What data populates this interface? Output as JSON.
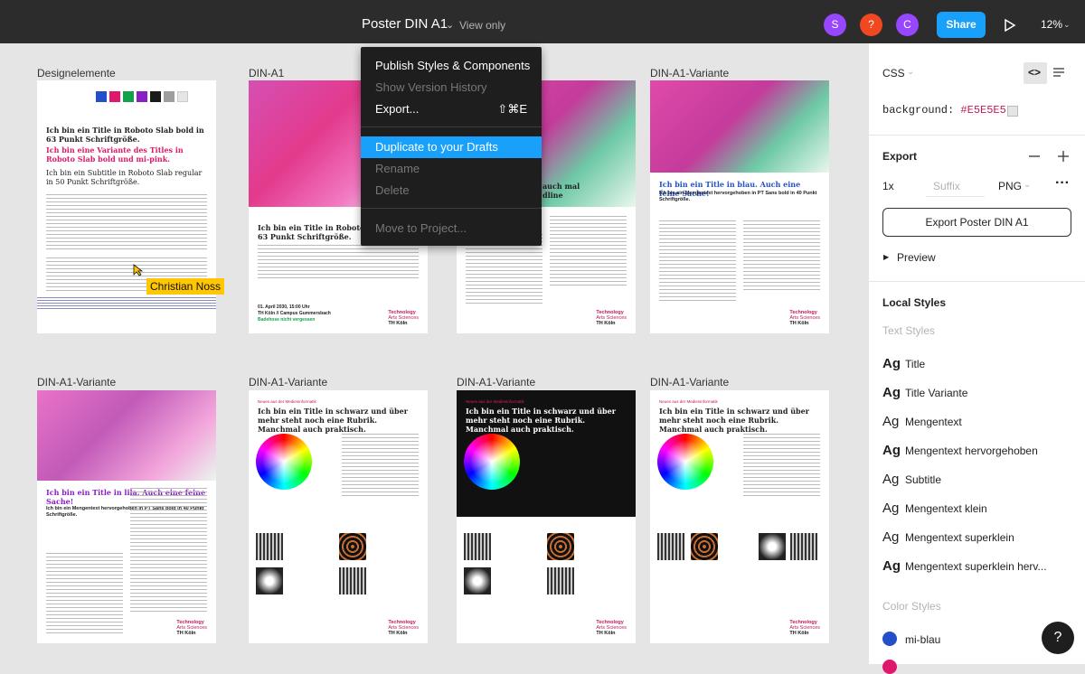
{
  "topbar": {
    "file_title": "Poster DIN A1",
    "view_only": "View only",
    "avatars": [
      {
        "letter": "S",
        "color": "#9747ff"
      },
      {
        "letter": "?",
        "color": "#f24822"
      },
      {
        "letter": "C",
        "color": "#9747ff"
      }
    ],
    "share_label": "Share",
    "zoom": "12%"
  },
  "dropdown": {
    "items": [
      {
        "label": "Publish Styles & Components",
        "state": "enabled"
      },
      {
        "label": "Show Version History",
        "state": "disabled"
      },
      {
        "label": "Export...",
        "shortcut": "⇧⌘E",
        "state": "enabled"
      },
      {
        "label": "Duplicate to your Drafts",
        "state": "highlighted"
      },
      {
        "label": "Rename",
        "state": "disabled"
      },
      {
        "label": "Delete",
        "state": "disabled"
      },
      {
        "label": "Move to Project...",
        "state": "disabled"
      }
    ]
  },
  "canvas": {
    "frames": [
      {
        "label": "Designelemente"
      },
      {
        "label": "DIN-A1"
      },
      {
        "label": ""
      },
      {
        "label": "DIN-A1-Variante"
      },
      {
        "label": "DIN-A1-Variante"
      },
      {
        "label": "DIN-A1-Variante"
      },
      {
        "label": "DIN-A1-Variante"
      },
      {
        "label": "DIN-A1-Variante"
      }
    ],
    "design_elements": {
      "swatches": [
        "#2350c8",
        "#e0186c",
        "#13a14b",
        "#8a1fc4",
        "#1a1a1a",
        "#9e9e9e",
        "#e5e5e5"
      ],
      "title_1": "Ich bin ein Title in Roboto Slab bold in 63 Punkt Schriftgröße.",
      "title_2": "Ich bin eine Variante des Titles in Roboto Slab bold und mi-pink.",
      "subtitle": "Ich bin ein Subtitle in Roboto Slab regular in 50 Punkt Schriftgröße."
    },
    "poster_1": {
      "title": "Ich bin ein Title in Roboto Slab bold in 63 Punkt Schriftgröße.",
      "body": "Mittellange Texte am Besten in der großen Mengentext Schrift setzen. Idealerweise über fünf bis sieben Spalten. Ich bin ein Mengentext in PT Sans. Lorem ipsum dolor sit amet, consectetur adipiscing elit, sed do eiusmod tempor incididunt ut labore et dolore magna aliqua. Ut enim ad minim veniam, quis nostrud exercitation ullamco laboris nisi ut aliquip ex ea commodo consequat.",
      "date": "01. April 2030, 15:00 Uhr",
      "place": "TH Köln // Campus Gummersbach",
      "note": "Badehose nicht vergessen"
    },
    "poster_3": {
      "partial_title_1": "auch mal",
      "partial_title_2": "dline"
    },
    "poster_4": {
      "title": "Ich bin ein Title in blau. Auch eine feine Sache!",
      "subtitle": "Ich bin ein Mengentext hervorgehoben in PT Sans bold in 40 Punkt Schriftgröße."
    },
    "poster_5": {
      "title": "Ich bin ein Title in lila. Auch eine feine Sache!",
      "subtitle": "Ich bin ein Mengentext hervorgehoben in PT Sans bold in 40 Punkt Schriftgröße."
    },
    "poster_6": {
      "kicker": "Neues aus der Medieninformatik",
      "title": "Ich bin ein Title in schwarz und über mehr steht noch eine Rubrik. Manchmal auch praktisch."
    },
    "poster_7": {
      "kicker": "Neues aus der Medieninformatik",
      "title": "Ich bin ein Title in schwarz und über mehr steht noch eine Rubrik. Manchmal auch praktisch."
    },
    "poster_8": {
      "kicker": "Neues aus der Medieninformatik",
      "title": "Ich bin ein Title in schwarz und über mehr steht noch eine Rubrik. Manchmal auch praktisch."
    },
    "logo": {
      "line1": "Technology",
      "line2": "Arts Sciences",
      "line3": "TH Köln"
    },
    "cursor_user": "Christian Noss"
  },
  "right_panel": {
    "code_language": "CSS",
    "css_property": "background:",
    "css_value": "#E5E5E5",
    "css_semicolon": ";",
    "export_heading": "Export",
    "export_scale": "1x",
    "export_suffix_placeholder": "Suffix",
    "export_format": "PNG",
    "export_button": "Export Poster DIN A1",
    "preview_label": "Preview",
    "local_styles_heading": "Local Styles",
    "text_styles_heading": "Text Styles",
    "ag_glyph": "Ag",
    "text_styles": [
      {
        "name": "Title",
        "weight": "bold"
      },
      {
        "name": "Title Variante",
        "weight": "bold"
      },
      {
        "name": "Mengentext",
        "weight": "normal"
      },
      {
        "name": "Mengentext hervorgehoben",
        "weight": "bold"
      },
      {
        "name": "Subtitle",
        "weight": "normal"
      },
      {
        "name": "Mengentext klein",
        "weight": "normal"
      },
      {
        "name": "Mengentext superklein",
        "weight": "normal"
      },
      {
        "name": "Mengentext superklein herv...",
        "weight": "bold"
      }
    ],
    "color_styles_heading": "Color Styles",
    "color_styles": [
      {
        "name": "mi-blau",
        "color": "#2350c8"
      }
    ]
  },
  "help_label": "?"
}
